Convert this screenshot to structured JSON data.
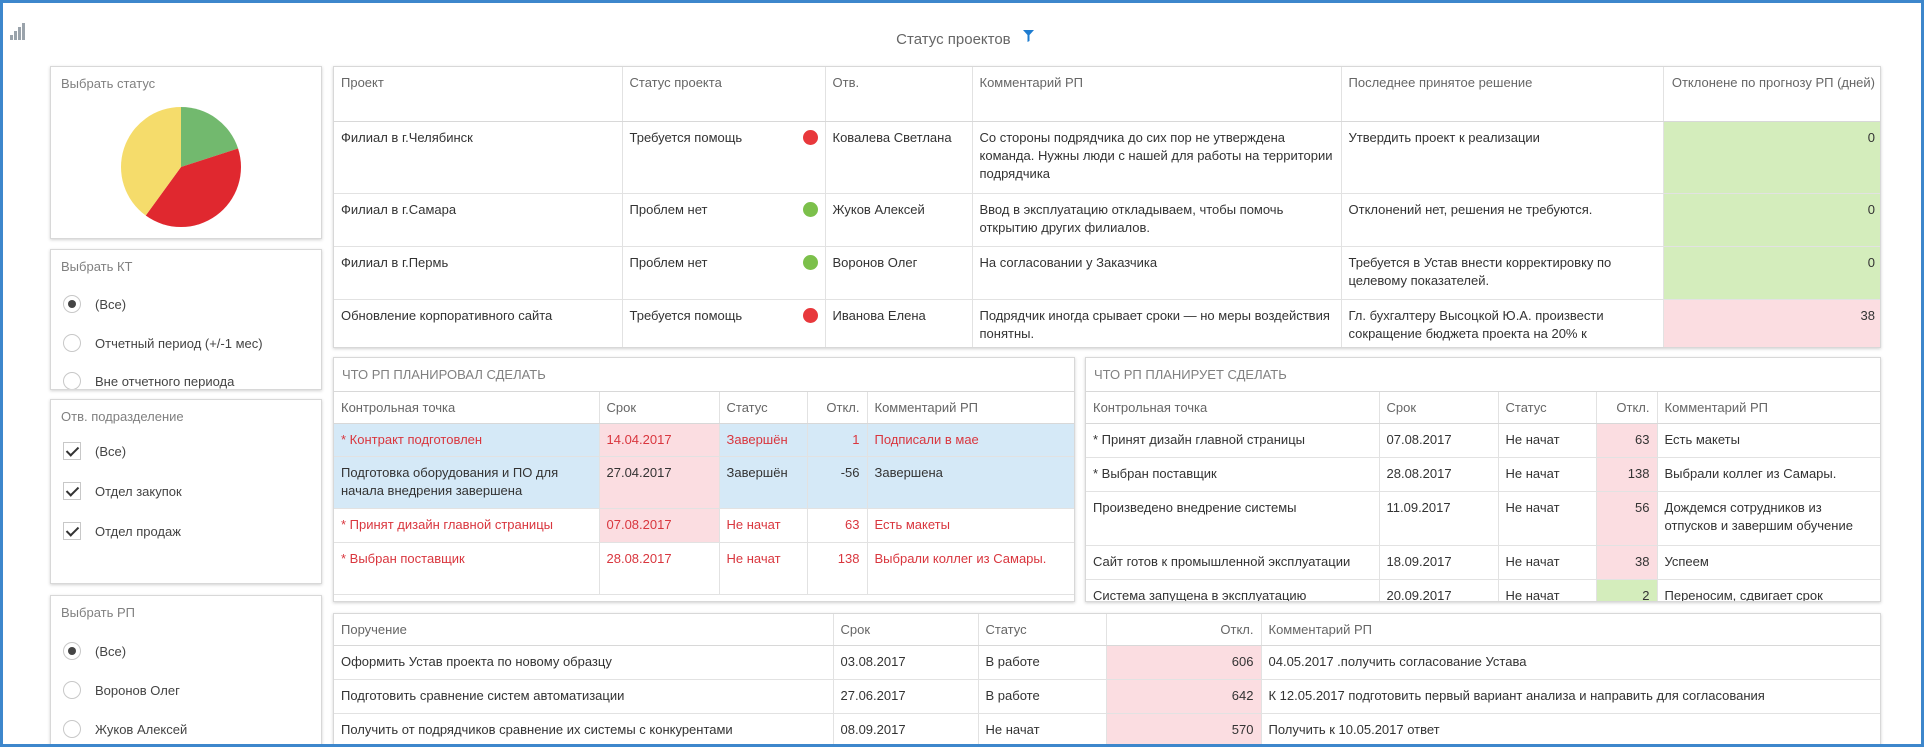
{
  "header": {
    "title": "Статус проектов"
  },
  "colors": {
    "frame": "#3d87cc",
    "red": "#e8383c",
    "green": "#7cc04b",
    "yellow": "#f5dc6b",
    "pink_cell": "#fbdde1",
    "green_cell": "#d4edbc",
    "blue_row": "#d5e9f7"
  },
  "filters": {
    "status": {
      "title": "Выбрать статус",
      "pie": [
        {
          "color": "#72b96e",
          "value": 20
        },
        {
          "color": "#e0282f",
          "value": 40
        },
        {
          "color": "#f5dc6b",
          "value": 40
        }
      ]
    },
    "kt": {
      "title": "Выбрать КТ",
      "options": [
        "(Все)",
        "Отчетный период (+/-1 мес)",
        "Вне отчетного периода"
      ]
    },
    "dept": {
      "title": "Отв. подразделение",
      "options": [
        "(Все)",
        "Отдел закупок",
        "Отдел продаж"
      ]
    },
    "rp": {
      "title": "Выбрать РП",
      "options": [
        "(Все)",
        "Воронов Олег",
        "Жуков Алексей"
      ]
    }
  },
  "projects": {
    "headers": [
      "Проект",
      "Статус проекта",
      "Отв.",
      "Комментарий РП",
      "Последнее принятое решение",
      "Отклонене по прогнозу РП (дней)"
    ],
    "rows": [
      {
        "project": "Филиал в г.Челябинск",
        "status": "Требуется помощь",
        "dot": "red",
        "owner": "Ковалева Светлана",
        "comment": "Со стороны подрядчика до сих пор не утверждена команда. Нужны люди с нашей для работы на территории подрядчика",
        "decision": "Утвердить проект к реализации",
        "dev": "0",
        "devColor": "green"
      },
      {
        "project": "Филиал в г.Самара",
        "status": "Проблем нет",
        "dot": "green",
        "owner": "Жуков Алексей",
        "comment": "Ввод в эксплуатацию откладываем, чтобы помочь открытию других филиалов.",
        "decision": "Отклонений нет, решения не требуются.",
        "dev": "0",
        "devColor": "green"
      },
      {
        "project": "Филиал в г.Пермь",
        "status": "Проблем нет",
        "dot": "green",
        "owner": "Воронов Олег",
        "comment": "На согласовании у Заказчика",
        "decision": "Требуется в Устав внести корректировку по целевому показателей.",
        "dev": "0",
        "devColor": "green"
      },
      {
        "project": "Обновление корпоративного сайта",
        "status": "Требуется помощь",
        "dot": "red",
        "owner": "Иванова Елена",
        "comment": "Подрядчик иногда срывает сроки — но меры воздействия понятны.",
        "decision": "Гл. бухгалтеру Высоцкой Ю.А. произвести сокращение бюджета проекта на 20% к",
        "dev": "38",
        "devColor": "pink"
      }
    ]
  },
  "planned": {
    "title": "ЧТО РП ПЛАНИРОВАЛ СДЕЛАТЬ",
    "headers": [
      "Контрольная точка",
      "Срок",
      "Статус",
      "Откл.",
      "Комментарий РП"
    ],
    "rows": [
      {
        "kt": "* Контракт подготовлен",
        "date": "14.04.2017",
        "status": "Завершён",
        "dev": "1",
        "comment": "Подписали в мае",
        "style": "blue-red"
      },
      {
        "kt": "Подготовка оборудования и ПО для начала внедрения завершена",
        "date": "27.04.2017",
        "status": "Завершён",
        "dev": "-56",
        "comment": "Завершена",
        "style": "blue"
      },
      {
        "kt": "* Принят дизайн главной страницы",
        "date": "07.08.2017",
        "status": "Не начат",
        "dev": "63",
        "comment": "Есть макеты",
        "style": "red"
      },
      {
        "kt": "* Выбран поставщик",
        "date": "28.08.2017",
        "status": "Не начат",
        "dev": "138",
        "comment": "Выбрали коллег из Самары.",
        "style": "red"
      }
    ]
  },
  "planning": {
    "title": "ЧТО РП ПЛАНИРУЕТ СДЕЛАТЬ",
    "headers": [
      "Контрольная точка",
      "Срок",
      "Статус",
      "Откл.",
      "Комментарий РП"
    ],
    "rows": [
      {
        "kt": "* Принят дизайн главной страницы",
        "date": "07.08.2017",
        "status": "Не начат",
        "dev": "63",
        "devColor": "pink",
        "comment": "Есть макеты"
      },
      {
        "kt": "* Выбран поставщик",
        "date": "28.08.2017",
        "status": "Не начат",
        "dev": "138",
        "devColor": "pink",
        "comment": "Выбрали коллег из Самары."
      },
      {
        "kt": "Произведено внедрение системы",
        "date": "11.09.2017",
        "status": "Не начат",
        "dev": "56",
        "devColor": "pink",
        "comment": "Дождемся сотрудников из отпусков и завершим обучение"
      },
      {
        "kt": "Сайт готов к промышленной эксплуатации",
        "date": "18.09.2017",
        "status": "Не начат",
        "dev": "38",
        "devColor": "pink",
        "comment": "Успеем"
      },
      {
        "kt": "Система запущена в эксплуатацию",
        "date": "20.09.2017",
        "status": "Не начат",
        "dev": "2",
        "devColor": "green",
        "comment": "Переносим, сдвигает срок"
      }
    ]
  },
  "orders": {
    "headers": [
      "Поручение",
      "Срок",
      "Статус",
      "Откл.",
      "Комментарий РП"
    ],
    "rows": [
      {
        "task": "Оформить Устав проекта по новому образцу",
        "date": "03.08.2017",
        "status": "В работе",
        "dev": "606",
        "comment": "04.05.2017 .получить согласование Устава"
      },
      {
        "task": "Подготовить сравнение систем автоматизации",
        "date": "27.06.2017",
        "status": "В работе",
        "dev": "642",
        "comment": "К 12.05.2017 подготовить первый вариант анализа и направить для согласования"
      },
      {
        "task": "Получить от подрядчиков сравнение их системы с конкурентами",
        "date": "08.09.2017",
        "status": "Не начат",
        "dev": "570",
        "comment": "Получить к 10.05.2017 ответ"
      }
    ]
  }
}
